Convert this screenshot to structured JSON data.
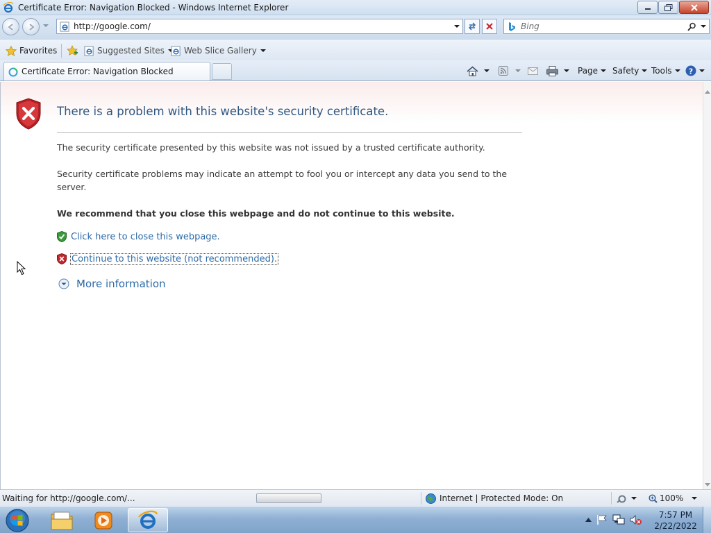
{
  "window": {
    "title": "Certificate Error: Navigation Blocked - Windows Internet Explorer"
  },
  "nav": {
    "address": "http://google.com/",
    "search_placeholder": "Bing"
  },
  "favorites_bar": {
    "favorites_label": "Favorites",
    "items": [
      {
        "label": "Suggested Sites"
      },
      {
        "label": "Web Slice Gallery"
      }
    ]
  },
  "tabs": [
    {
      "title": "Certificate Error: Navigation Blocked",
      "active": true
    }
  ],
  "command_bar": {
    "page_label": "Page",
    "safety_label": "Safety",
    "tools_label": "Tools"
  },
  "page": {
    "title": "There is a problem with this website's security certificate.",
    "paragraph1": "The security certificate presented by this website was not issued by a trusted certificate authority.",
    "paragraph2": "Security certificate problems may indicate an attempt to fool you or intercept any data you send to the server.",
    "recommendation": "We recommend that you close this webpage and do not continue to this website.",
    "close_link": "Click here to close this webpage.",
    "continue_link": "Continue to this website (not recommended).",
    "more_info_link": "More information"
  },
  "status_bar": {
    "status_text": "Waiting for http://google.com/...",
    "zone": "Internet | Protected Mode: On",
    "zoom": "100%"
  },
  "taskbar": {
    "time": "7:57 PM",
    "date": "2/22/2022"
  },
  "colors": {
    "link": "#2c6aa8",
    "title_text": "#2f5882",
    "error_red": "#c4272b",
    "safe_green": "#3b9a3b"
  }
}
